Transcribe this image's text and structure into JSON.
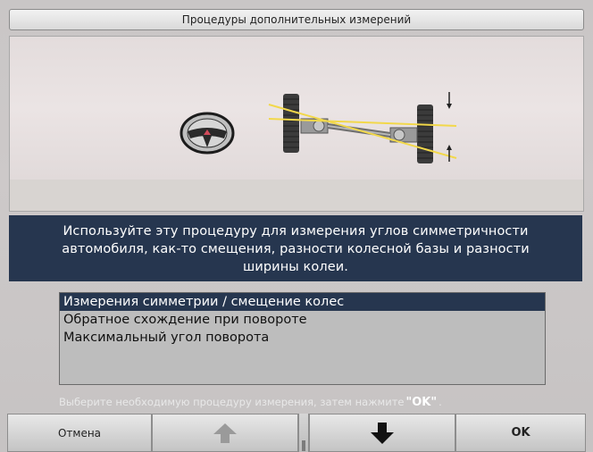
{
  "window": {
    "title": "Процедуры дополнительных измерений"
  },
  "illustration": {
    "icons": [
      "steering-wheel-icon",
      "axle-alignment-icon"
    ]
  },
  "description": {
    "lines": [
      "Используйте эту процедуру для измерения углов симметричности",
      "автомобиля, как-то смещения, разности колесной базы и разности",
      "ширины колеи."
    ]
  },
  "procedures": {
    "items": [
      {
        "label": "Измерения симметрии / смещение колес",
        "selected": true
      },
      {
        "label": "Обратное схождение при повороте",
        "selected": false
      },
      {
        "label": "Максимальный угол поворота",
        "selected": false
      }
    ]
  },
  "hint": {
    "text_before": "Выберите необходимую процедуру измерения, затем нажмите",
    "ok_quote": "\"OK\"",
    "text_after": "."
  },
  "toolbar": {
    "cancel_label": "Отмена",
    "up_icon": "arrow-up-icon",
    "down_icon": "arrow-down-icon",
    "ok_label": "OK"
  },
  "colors": {
    "selection": "#26364f",
    "panel": "#d8d4d1",
    "list_bg": "#bdbdbd"
  }
}
